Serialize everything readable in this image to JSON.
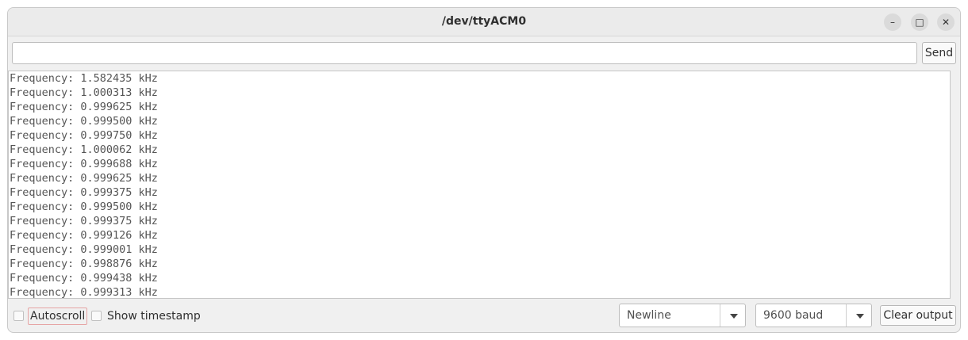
{
  "window": {
    "title": "/dev/ttyACM0",
    "controls": {
      "minimize": "–",
      "maximize": "□",
      "close": "✕"
    }
  },
  "send": {
    "input_value": "",
    "button_label": "Send"
  },
  "output": {
    "lines": [
      "Frequency: 1.582435 kHz",
      "Frequency: 1.000313 kHz",
      "Frequency: 0.999625 kHz",
      "Frequency: 0.999500 kHz",
      "Frequency: 0.999750 kHz",
      "Frequency: 1.000062 kHz",
      "Frequency: 0.999688 kHz",
      "Frequency: 0.999625 kHz",
      "Frequency: 0.999375 kHz",
      "Frequency: 0.999500 kHz",
      "Frequency: 0.999375 kHz",
      "Frequency: 0.999126 kHz",
      "Frequency: 0.999001 kHz",
      "Frequency: 0.998876 kHz",
      "Frequency: 0.999438 kHz",
      "Frequency: 0.999313 kHz"
    ]
  },
  "footer": {
    "autoscroll_label": "Autoscroll",
    "autoscroll_checked": false,
    "timestamp_label": "Show timestamp",
    "timestamp_checked": false,
    "line_ending": "Newline",
    "baud_rate": "9600 baud",
    "clear_label": "Clear output"
  }
}
